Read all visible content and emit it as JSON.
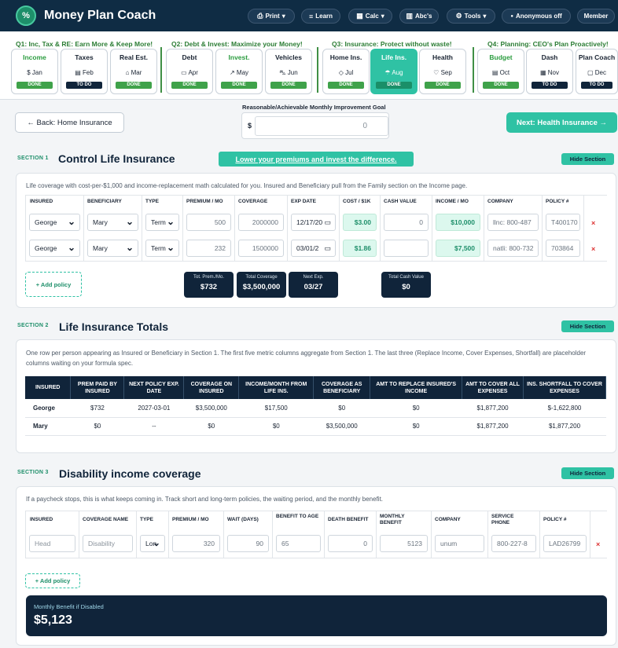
{
  "app": {
    "logo_glyph": "%",
    "title": "Money Plan Coach"
  },
  "toolbar": {
    "print": "Print",
    "learn": "Learn",
    "calc": "Calc",
    "abcs": "Abc's",
    "tools": "Tools",
    "anon": "Anonymous off",
    "member": "Member"
  },
  "quarters": [
    {
      "title": "Q1: Inc, Tax & RE: Earn More & Keep More!"
    },
    {
      "title": "Q2: Debt & Invest: Maximize your Money!"
    },
    {
      "title": "Q3: Insurance: Protect without waste!"
    },
    {
      "title": "Q4: Planning: CEO's Plan Proactively!"
    }
  ],
  "months": [
    {
      "name": "Income",
      "icon": "dollar-icon",
      "glyph": "$",
      "month": "Jan",
      "status": "DONE"
    },
    {
      "name": "Taxes",
      "icon": "document-icon",
      "glyph": "▤",
      "month": "Feb",
      "status": "TO DO"
    },
    {
      "name": "Real Est.",
      "icon": "home-icon",
      "glyph": "⌂",
      "month": "Mar",
      "status": "DONE"
    },
    {
      "name": "Debt",
      "icon": "card-icon",
      "glyph": "▭",
      "month": "Apr",
      "status": "DONE"
    },
    {
      "name": "Invest.",
      "icon": "chart-icon",
      "glyph": "↗",
      "month": "May",
      "status": "DONE"
    },
    {
      "name": "Vehicles",
      "icon": "car-icon",
      "glyph": "⛍",
      "month": "Jun",
      "status": "DONE"
    },
    {
      "name": "Home Ins.",
      "icon": "shield-icon",
      "glyph": "◇",
      "month": "Jul",
      "status": "DONE"
    },
    {
      "name": "Life Ins.",
      "icon": "umbrella-icon",
      "glyph": "☂",
      "month": "Aug",
      "status": "DONE"
    },
    {
      "name": "Health",
      "icon": "heart-icon",
      "glyph": "♡",
      "month": "Sep",
      "status": "DONE"
    },
    {
      "name": "Budget",
      "icon": "clipboard-icon",
      "glyph": "▤",
      "month": "Oct",
      "status": "DONE"
    },
    {
      "name": "Dash",
      "icon": "grid-icon",
      "glyph": "▦",
      "month": "Nov",
      "status": "TO DO"
    },
    {
      "name": "Plan Coach",
      "icon": "chat-icon",
      "glyph": "▢",
      "month": "Dec",
      "status": "TO DO"
    }
  ],
  "nav": {
    "back": "← Back: Home Insurance",
    "next": "Next: Health Insurance →",
    "goal_label": "Reasonable/Achievable Monthly Improvement Goal",
    "goal_currency": "$",
    "goal_value": "0"
  },
  "section1": {
    "tag": "SECTION 1",
    "title": "Control Life Insurance",
    "promo": "Lower your premiums and invest the difference.",
    "hide": "Hide Section",
    "desc": "Life coverage with cost-per-$1,000 and income-replacement math calculated for you. Insured and Beneficiary pull from the Family section on the Income page.",
    "headers": [
      "INSURED",
      "BENEFICIARY",
      "TYPE",
      "PREMIUM / MO",
      "COVERAGE",
      "EXP DATE",
      "COST / $1K",
      "CASH VALUE",
      "INCOME / MO",
      "COMPANY",
      "POLICY #"
    ],
    "rows": [
      {
        "insured": "George",
        "beneficiary": "Mary",
        "type": "Term",
        "premium": "500",
        "coverage": "2000000",
        "exp": "12/17/20",
        "cost": "$3.00",
        "cash": "0",
        "income": "$10,000",
        "company": "llnc: 800-487",
        "policy": "T400170"
      },
      {
        "insured": "George",
        "beneficiary": "Mary",
        "type": "Term",
        "premium": "232",
        "coverage": "1500000",
        "exp": "03/01/2",
        "cost": "$1.86",
        "cash": "",
        "income": "$7,500",
        "company": "natli: 800-732",
        "policy": "703864"
      }
    ],
    "remove": "×",
    "add": "+ Add policy",
    "stats": [
      {
        "label": "Tot. Prem./Mo.",
        "value": "$732"
      },
      {
        "label": "Total Coverage",
        "value": "$3,500,000"
      },
      {
        "label": "Next Exp.",
        "value": "03/27"
      },
      {
        "label": "Total Cash Value",
        "value": "$0"
      }
    ]
  },
  "section2": {
    "tag": "SECTION 2",
    "title": "Life Insurance Totals",
    "hide": "Hide Section",
    "desc": "One row per person appearing as Insured or Beneficiary in Section 1. The first five metric columns aggregate from Section 1. The last three (Replace Income, Cover Expenses, Shortfall) are placeholder columns waiting on your formula spec.",
    "headers": [
      "INSURED",
      "PREM PAID BY INSURED",
      "NEXT POLICY EXP. DATE",
      "COVERAGE ON INSURED",
      "INCOME/MONTH FROM LIFE INS.",
      "COVERAGE AS BENEFICIARY",
      "AMT TO REPLACE INSURED'S INCOME",
      "AMT TO COVER ALL EXPENSES",
      "INS. SHORTFALL TO COVER EXPENSES"
    ],
    "rows": [
      [
        "George",
        "$732",
        "2027-03-01",
        "$3,500,000",
        "$17,500",
        "$0",
        "$0",
        "$1,877,200",
        "$-1,622,800"
      ],
      [
        "Mary",
        "$0",
        "--",
        "$0",
        "$0",
        "$3,500,000",
        "$0",
        "$1,877,200",
        "$1,877,200"
      ]
    ]
  },
  "section3": {
    "tag": "SECTION 3",
    "title": "Disability income coverage",
    "hide": "Hide Section",
    "desc": "If a paycheck stops, this is what keeps coming in. Track short and long-term policies, the waiting period, and the monthly benefit.",
    "headers": [
      "INSURED",
      "COVERAGE NAME",
      "TYPE",
      "PREMIUM / MO",
      "WAIT (DAYS)",
      "BENEFIT TO AGE",
      "DEATH BENEFIT",
      "MONTHLY BENEFIT",
      "COMPANY",
      "SERVICE PHONE",
      "POLICY #"
    ],
    "row": {
      "insured": "Head",
      "coverage": "Disability",
      "type": "Lon",
      "premium": "320",
      "wait": "90",
      "age": "65",
      "death": "0",
      "benefit": "5123",
      "company": "unum",
      "phone": "800-227-8",
      "policy": "LAD26799"
    },
    "remove": "×",
    "add": "+ Add policy",
    "stat_label": "Monthly Benefit if Disabled",
    "stat_value": "$5,123"
  }
}
